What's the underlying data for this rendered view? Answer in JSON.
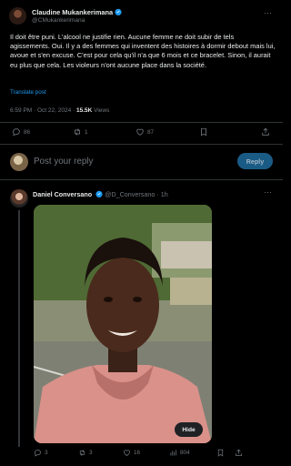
{
  "post": {
    "author_name": "Claudine Mukankerimana",
    "author_handle": "@CMukankerimana",
    "more_label": "···",
    "text": "Il doit être puni. L'alcool ne justifie rien. Aucune femme ne doit subir de tels agissements. Oui. Il y a des femmes qui inventent des histoires à dormir debout mais lui, avoue et s'en excuse. C'est pour cela qu'il n'a que 6 mois et ce bracelet. Sinon, il aurait eu plus que cela. Les violeurs n'ont aucune place dans la société.",
    "translate_label": "Translate post",
    "timestamp": "6:59 PM · Oct 22, 2024 · ",
    "views_count": "15.5K",
    "views_label": " Views",
    "actions": {
      "replies": "86",
      "reposts": "1",
      "likes": "87",
      "bookmarks": "",
      "share": ""
    }
  },
  "composer": {
    "placeholder": "Post your reply",
    "reply_button": "Reply"
  },
  "reply": {
    "author_name": "Daniel Conversano",
    "author_handle": "@D_Conversano · 1h",
    "more_label": "···",
    "hide_label": "Hide",
    "actions": {
      "replies": "3",
      "reposts": "3",
      "likes": "16",
      "views": "804"
    }
  },
  "colors": {
    "accent": "#1d9bf0",
    "muted": "#71767b",
    "background": "#000000",
    "text": "#e7e9ea"
  }
}
